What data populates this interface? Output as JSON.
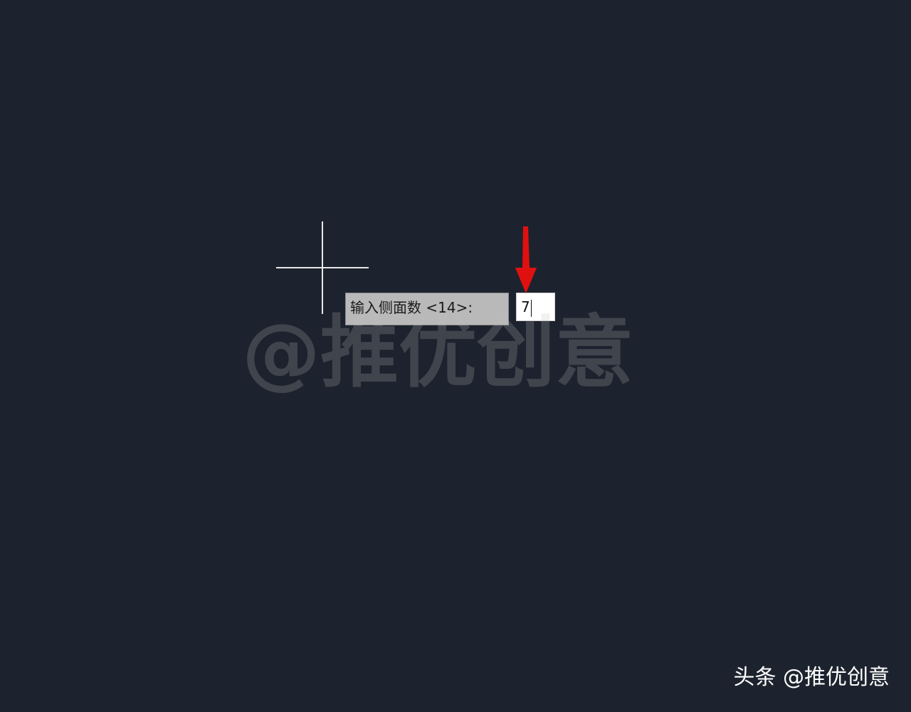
{
  "prompt": {
    "label": "输入侧面数 <14>:",
    "value": "7"
  },
  "watermark": {
    "text": "@推优创意"
  },
  "credit": {
    "text": "头条 @推优创意"
  },
  "colors": {
    "background": "#1d232e",
    "crosshair": "#e8e8e8",
    "tooltip": "#b9b9b9",
    "input": "#ffffff",
    "arrow": "#e01010"
  },
  "icons": {
    "cursor": "crosshair-cursor-icon",
    "annotation": "red-down-arrow-icon"
  }
}
